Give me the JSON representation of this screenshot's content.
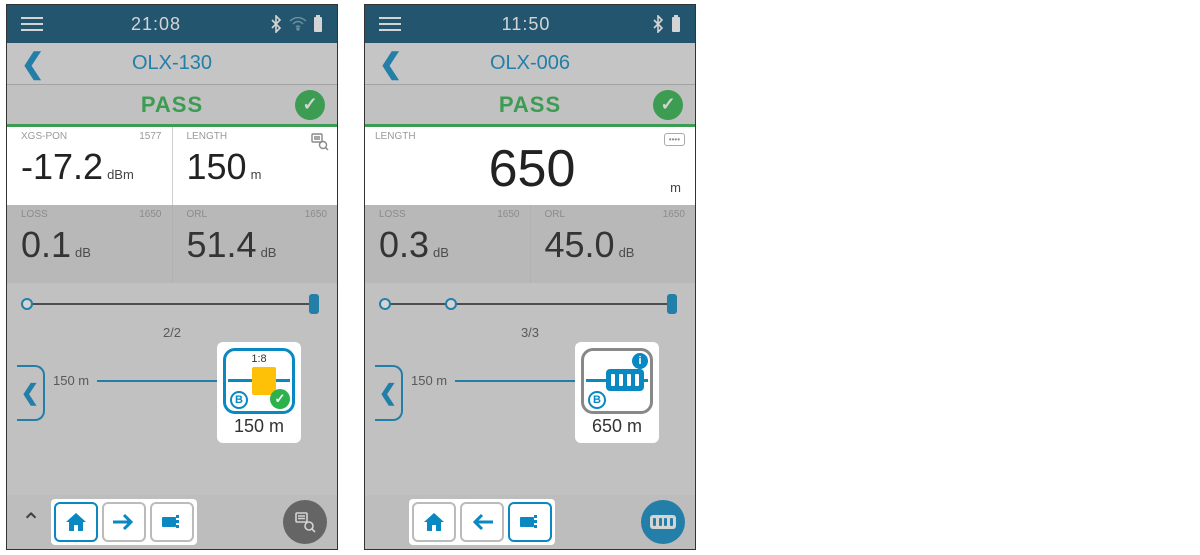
{
  "screens": [
    {
      "status": {
        "time": "21:08"
      },
      "header": {
        "title": "OLX-130"
      },
      "result": "PASS",
      "row1": {
        "left": {
          "label": "XGS-PON",
          "sublabel": "1577",
          "value": "-17.2",
          "unit": "dBm"
        },
        "right": {
          "label": "LENGTH",
          "sublabel": "",
          "value": "150",
          "unit": "m"
        }
      },
      "row2": {
        "left": {
          "label": "LOSS",
          "sublabel": "1650",
          "value": "0.1",
          "unit": "dB"
        },
        "right": {
          "label": "ORL",
          "sublabel": "1650",
          "value": "51.4",
          "unit": "dB"
        }
      },
      "event": {
        "counter": "2/2",
        "distance": "150 m",
        "ratio": "1:8",
        "marker": "B",
        "total": "150 m",
        "kind": "splitter"
      }
    },
    {
      "status": {
        "time": "11:50"
      },
      "header": {
        "title": "OLX-006"
      },
      "result": "PASS",
      "row1_single": {
        "label": "LENGTH",
        "value": "650",
        "unit": "m"
      },
      "row2": {
        "left": {
          "label": "LOSS",
          "sublabel": "1650",
          "value": "0.3",
          "unit": "dB"
        },
        "right": {
          "label": "ORL",
          "sublabel": "1650",
          "value": "45.0",
          "unit": "dB"
        }
      },
      "event": {
        "counter": "3/3",
        "distance": "150 m",
        "marker": "B",
        "total": "650 m",
        "kind": "connector"
      }
    }
  ]
}
